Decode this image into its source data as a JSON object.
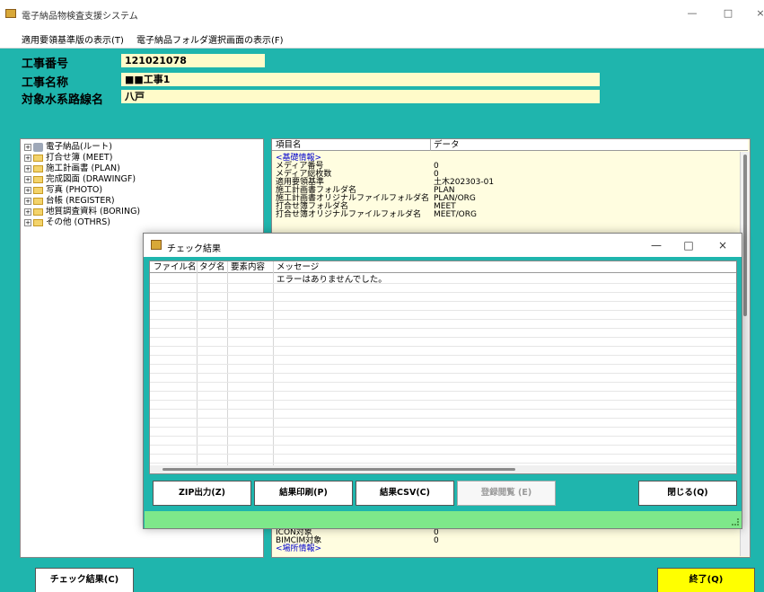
{
  "window": {
    "title": "電子納品物検査支援システム",
    "controls": [
      "—",
      "□",
      "×"
    ]
  },
  "menu": [
    "適用要領基準版の表示(T)",
    "電子納品フォルダ選択画面の表示(F)"
  ],
  "fields": {
    "construction_number": {
      "label": "工事番号",
      "value": "121021078"
    },
    "construction_name": {
      "label": "工事名称",
      "value": "■■工事1"
    },
    "river_route_name": {
      "label": "対象水系路線名",
      "value": "八戸"
    }
  },
  "tree": [
    {
      "label": "電子納品(ルート)",
      "icon": "root-icon"
    },
    {
      "label": "打合せ簿 (MEET)",
      "icon": "folder-icon"
    },
    {
      "label": "施工計画書 (PLAN)",
      "icon": "folder-icon"
    },
    {
      "label": "完成図面 (DRAWINGF)",
      "icon": "folder-icon"
    },
    {
      "label": "写真 (PHOTO)",
      "icon": "folder-icon"
    },
    {
      "label": "台帳 (REGISTER)",
      "icon": "folder-icon"
    },
    {
      "label": "地質調査資料 (BORING)",
      "icon": "folder-icon"
    },
    {
      "label": "その他 (OTHRS)",
      "icon": "folder-icon"
    }
  ],
  "properties": {
    "headers": [
      "項目名",
      "データ"
    ],
    "rows": [
      {
        "name": "<基礎情報>",
        "value": "",
        "section": true
      },
      {
        "name": "メディア番号",
        "value": "0"
      },
      {
        "name": "メディア総枚数",
        "value": "0"
      },
      {
        "name": "適用要領基準",
        "value": "土木202303-01"
      },
      {
        "name": "施工計画書フォルダ名",
        "value": "PLAN"
      },
      {
        "name": "施工計画書オリジナルファイルフォルダ名",
        "value": "PLAN/ORG"
      },
      {
        "name": "打合せ簿フォルダ名",
        "value": "MEET"
      },
      {
        "name": "打合せ簿オリジナルファイルフォルダ名",
        "value": "MEET/ORG"
      }
    ],
    "bottom_rows": [
      {
        "name": "ICON対象",
        "value": "0"
      },
      {
        "name": "BIMCIM対象",
        "value": "0"
      },
      {
        "name": "<場所情報>",
        "value": "",
        "section": true
      }
    ]
  },
  "dialog": {
    "title": "チェック結果",
    "controls": [
      "—",
      "□",
      "×"
    ],
    "columns": [
      "ファイル名",
      "タグ名",
      "要素内容",
      "メッセージ"
    ],
    "rows": [
      {
        "file": "",
        "tag": "",
        "element": "",
        "message": "エラーはありませんでした。"
      }
    ],
    "buttons": {
      "zip": "ZIP出力(Z)",
      "print": "結果印刷(P)",
      "csv": "結果CSV(C)",
      "register": "登録閲覧 (E)",
      "close": "閉じる(Q)"
    }
  },
  "bottom": {
    "check_result": "チェック結果(C)",
    "exit": "終了(Q)"
  },
  "colors": {
    "background": "#1fb5ad",
    "field_bg": "#fffbc9",
    "exit_button": "#ffff00",
    "status_bar": "#7ee88a",
    "section_text": "#0000cc"
  }
}
